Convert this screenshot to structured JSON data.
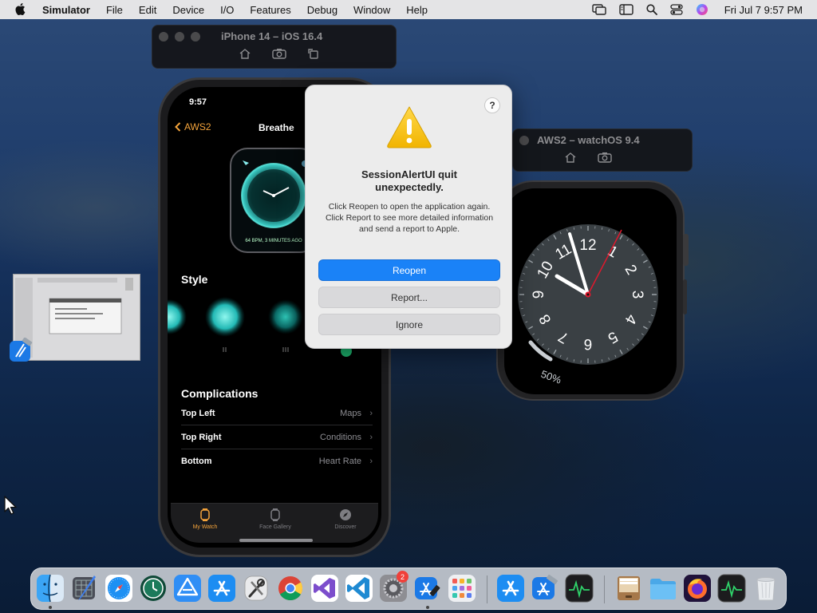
{
  "menubar": {
    "app_name": "Simulator",
    "items": [
      "File",
      "Edit",
      "Device",
      "I/O",
      "Features",
      "Debug",
      "Window",
      "Help"
    ],
    "clock": "Fri Jul 7  9:57 PM"
  },
  "iphone_window": {
    "title": "iPhone 14 – iOS 16.4"
  },
  "watch_window": {
    "title": "AWS2 – watchOS 9.4"
  },
  "iphone": {
    "status_time": "9:57",
    "nav_back_label": "AWS2",
    "nav_title": "Breathe",
    "face_thumb_caption": "64 BPM, 3 MINUTES AGO",
    "style_section": "Style",
    "complications_section": "Complications",
    "complications": [
      {
        "label": "Top Left",
        "value": "Maps"
      },
      {
        "label": "Top Right",
        "value": "Conditions"
      },
      {
        "label": "Bottom",
        "value": "Heart Rate"
      }
    ],
    "tabs": [
      {
        "label": "My Watch",
        "icon": "watch-icon"
      },
      {
        "label": "Face Gallery",
        "icon": "face-gallery-icon"
      },
      {
        "label": "Discover",
        "icon": "compass-icon"
      }
    ]
  },
  "watch": {
    "numerals": [
      "12",
      "1",
      "2",
      "3",
      "4",
      "5",
      "6",
      "7",
      "8",
      "9",
      "10",
      "11"
    ],
    "battery": "50%",
    "battery_level": 0.5
  },
  "alert": {
    "help": "?",
    "title": "SessionAlertUI quit unexpectedly.",
    "message": "Click Reopen to open the application again. Click Report to see more detailed information and send a report to Apple.",
    "buttons": {
      "reopen": "Reopen",
      "report": "Report...",
      "ignore": "Ignore"
    }
  },
  "dock": {
    "badge_count": "2"
  },
  "colors": {
    "accent_blue": "#1a82f7",
    "watch_orange": "#f3a33b",
    "warning_yellow": "#f5c518",
    "second_hand_red": "#e0182d"
  }
}
